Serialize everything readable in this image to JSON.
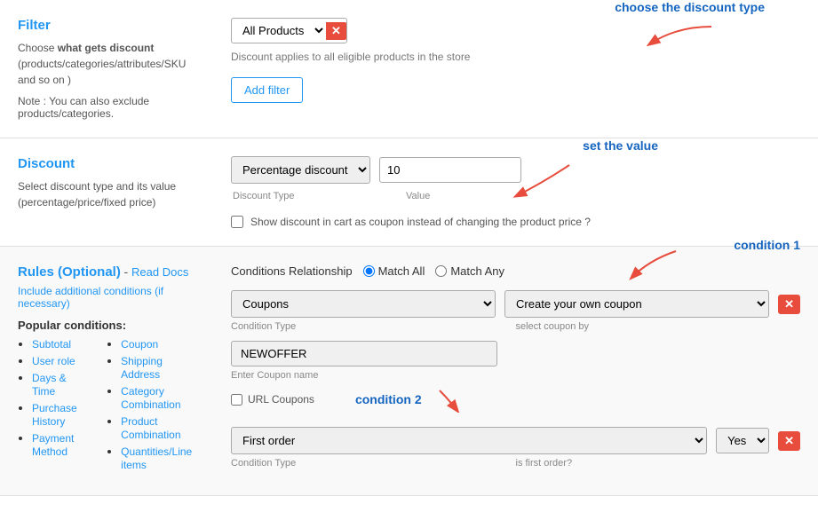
{
  "filter": {
    "title": "Filter",
    "desc1": "Choose ",
    "desc_bold": "what gets discount",
    "desc2": " (products/categories/attributes/SKU and so on )",
    "note": "Note : You can also exclude products/categories.",
    "dropdown_value": "All Products",
    "hint": "Discount applies to all eligible products in the store",
    "add_filter_label": "Add filter",
    "annotation": "choose the discount type"
  },
  "discount": {
    "title": "Discount",
    "desc": "Select discount type and its value (percentage/price/fixed price)",
    "type_label": "Discount Type",
    "value_label": "Value",
    "type_value": "Percentage discount",
    "value": "10",
    "checkbox_label": "Show discount in cart as coupon instead of changing the product price ?",
    "annotation": "set the value"
  },
  "rules": {
    "title": "Rules (Optional)",
    "read_docs": "Read Docs",
    "subtitle": "Include additional conditions (if necessary)",
    "popular_title": "Popular conditions:",
    "col1": [
      {
        "label": "Subtotal",
        "href": "#"
      },
      {
        "label": "User role",
        "href": "#"
      },
      {
        "label": "Days & Time",
        "href": "#"
      },
      {
        "label": "Purchase History",
        "href": "#"
      },
      {
        "label": "Payment Method",
        "href": "#"
      }
    ],
    "col2": [
      {
        "label": "Coupon",
        "href": "#"
      },
      {
        "label": "Shipping Address",
        "href": "#"
      },
      {
        "label": "Category Combination",
        "href": "#"
      },
      {
        "label": "Product Combination",
        "href": "#"
      },
      {
        "label": "Quantities/Line items",
        "href": "#"
      }
    ],
    "conditions_label": "Conditions Relationship",
    "match_all": "Match All",
    "match_any": "Match Any",
    "condition1": {
      "type": "Coupons",
      "select_by": "Create your own coupon",
      "type_label": "Condition Type",
      "select_label": "select coupon by",
      "coupon_name": "NEWOFFER",
      "coupon_name_label": "Enter Coupon name",
      "url_coupon_label": "URL Coupons",
      "annotation": "condition 1"
    },
    "condition2": {
      "type": "First order",
      "value": "Yes",
      "type_label": "Condition Type",
      "value_label": "is first order?",
      "annotation": "condition 2"
    }
  }
}
